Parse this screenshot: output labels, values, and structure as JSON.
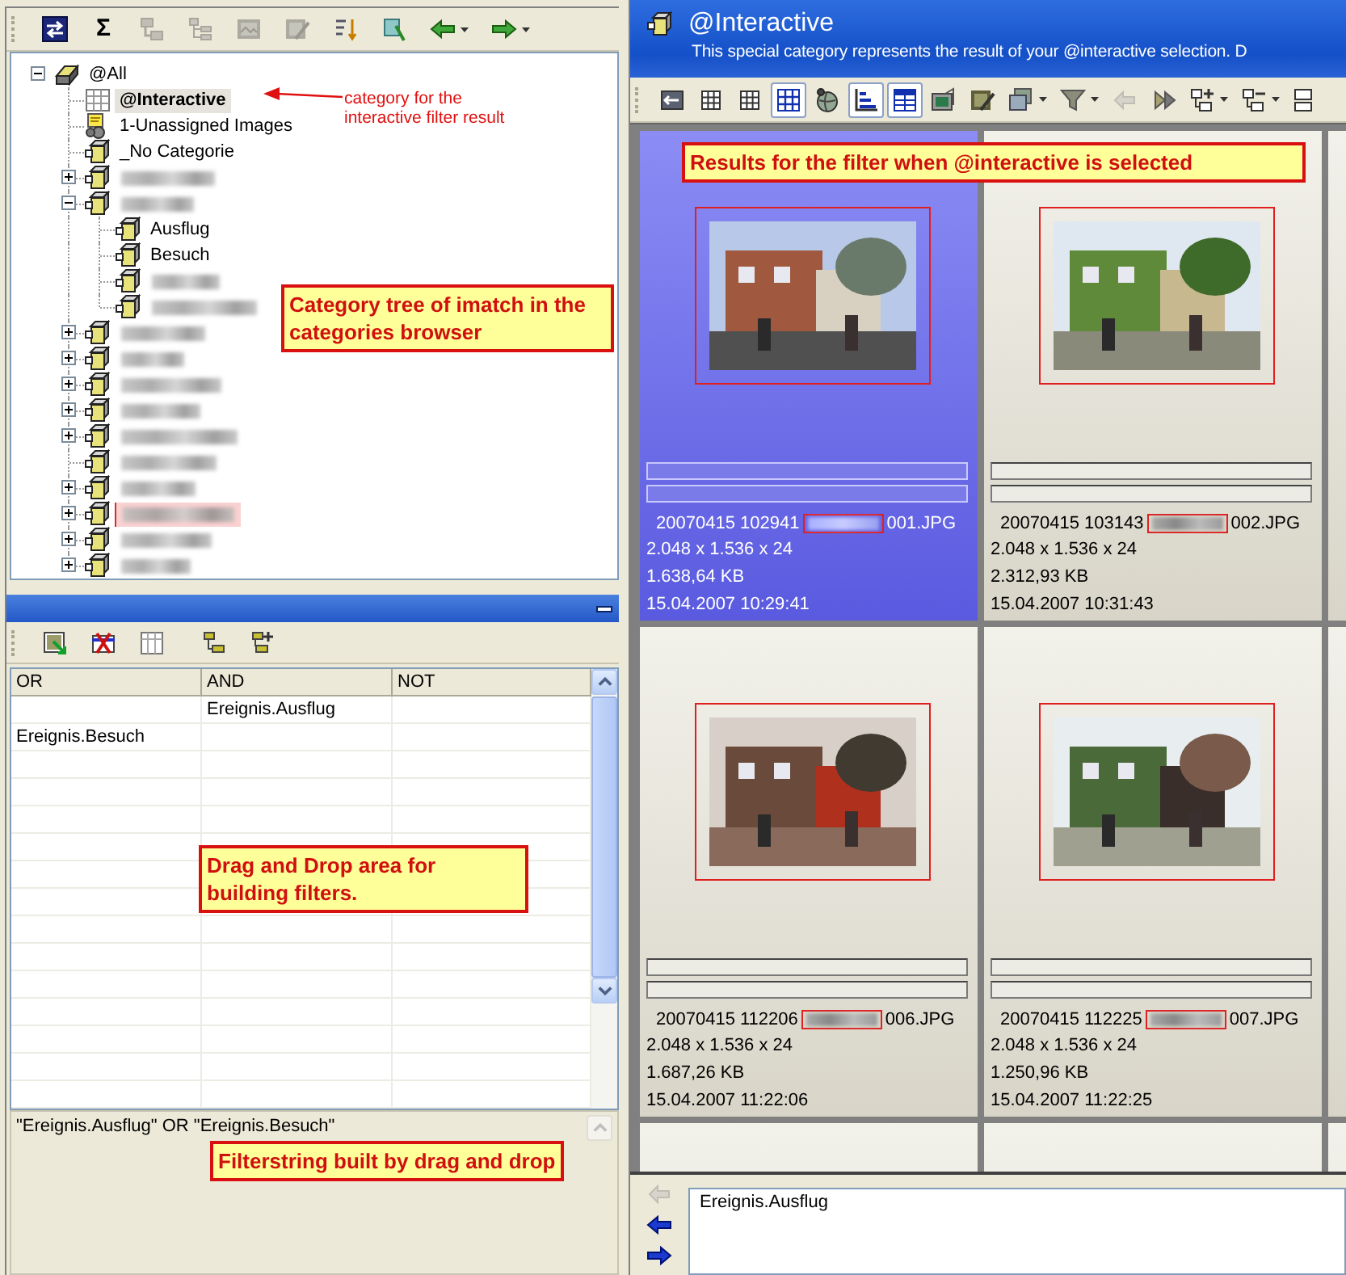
{
  "categories_toolbar": [
    {
      "kind": "swap",
      "disabled": false,
      "dropdown": false
    },
    {
      "kind": "text",
      "label": "Σ",
      "disabled": false,
      "dropdown": false
    },
    {
      "kind": "tree-collapse",
      "disabled": true,
      "dropdown": false
    },
    {
      "kind": "tree-expand",
      "disabled": true,
      "dropdown": false
    },
    {
      "kind": "image-grid",
      "disabled": true,
      "dropdown": false
    },
    {
      "kind": "image-edit",
      "disabled": true,
      "dropdown": false
    },
    {
      "kind": "sort",
      "disabled": false,
      "dropdown": false
    },
    {
      "kind": "select",
      "disabled": false,
      "dropdown": false
    },
    {
      "kind": "arrow-left",
      "disabled": false,
      "dropdown": true
    },
    {
      "kind": "arrow-right",
      "disabled": false,
      "dropdown": true
    }
  ],
  "tree": [
    {
      "kind": "drive",
      "label": "@All",
      "expanded": true,
      "selected": false,
      "highlighted": false,
      "children": [
        {
          "kind": "grid",
          "label": "@Interactive",
          "selected": true,
          "highlighted": false
        },
        {
          "kind": "special",
          "label": "1-Unassigned Images",
          "selected": false,
          "highlighted": false
        },
        {
          "kind": "category",
          "label": "_No Categorie",
          "selected": false,
          "highlighted": false
        },
        {
          "kind": "category",
          "expanded": false,
          "selected": false,
          "highlighted": false
        },
        {
          "kind": "category",
          "expanded": true,
          "selected": false,
          "highlighted": false,
          "children": [
            {
              "kind": "category",
              "label": "Ausflug",
              "selected": false,
              "highlighted": false
            },
            {
              "kind": "category",
              "label": "Besuch",
              "selected": false,
              "highlighted": false
            },
            {
              "kind": "category",
              "selected": false,
              "highlighted": false
            },
            {
              "kind": "category",
              "selected": false,
              "highlighted": false
            }
          ]
        },
        {
          "kind": "category",
          "expanded": false,
          "selected": false,
          "highlighted": false
        },
        {
          "kind": "category",
          "expanded": false,
          "selected": false,
          "highlighted": false
        },
        {
          "kind": "category",
          "expanded": false,
          "selected": false,
          "highlighted": false
        },
        {
          "kind": "category",
          "expanded": false,
          "selected": false,
          "highlighted": false
        },
        {
          "kind": "category",
          "expanded": false,
          "selected": false,
          "highlighted": false
        },
        {
          "kind": "category",
          "selected": false,
          "highlighted": false
        },
        {
          "kind": "category",
          "expanded": false,
          "selected": false,
          "highlighted": false
        },
        {
          "kind": "category",
          "expanded": false,
          "selected": false,
          "highlighted": true
        },
        {
          "kind": "category",
          "expanded": false,
          "selected": false,
          "highlighted": false
        },
        {
          "kind": "category",
          "expanded": false,
          "selected": false,
          "highlighted": false
        }
      ]
    }
  ],
  "tree_note": {
    "text": "category for the interactive filter result"
  },
  "tree_callout": {
    "text": "Category tree of imatch in the categories browser"
  },
  "filter_toolbar": [
    {
      "kind": "image-add",
      "disabled": false
    },
    {
      "kind": "delete",
      "disabled": false
    },
    {
      "kind": "table",
      "disabled": false
    },
    {
      "kind": "tree-node",
      "disabled": false
    },
    {
      "kind": "tree-add",
      "disabled": false
    }
  ],
  "filter_grid": {
    "columns": [
      "OR",
      "AND",
      "NOT"
    ],
    "rows": [
      {
        "and": "Ereignis.Ausflug"
      },
      {
        "or": "Ereignis.Besuch"
      }
    ],
    "callout": {
      "text": "Drag and Drop area for building filters."
    }
  },
  "filter_string": {
    "text": "\"Ereignis.Ausflug\" OR \"Ereignis.Besuch\"",
    "callout": {
      "text": "Filterstring built by drag and drop"
    }
  },
  "header": {
    "title": "@Interactive",
    "description": "This special category represents the result of your @interactive selection. D"
  },
  "view_toolbar": [
    {
      "kind": "exit",
      "pressed": false,
      "disabled": false,
      "dropdown": false
    },
    {
      "kind": "grid3",
      "pressed": false,
      "disabled": false,
      "dropdown": false
    },
    {
      "kind": "grid3",
      "pressed": false,
      "disabled": false,
      "dropdown": false
    },
    {
      "kind": "grid4",
      "pressed": true,
      "disabled": false,
      "dropdown": false
    },
    {
      "kind": "globe",
      "pressed": false,
      "disabled": false,
      "dropdown": false
    },
    {
      "kind": "align",
      "pressed": true,
      "disabled": false,
      "dropdown": false
    },
    {
      "kind": "table-lines",
      "pressed": true,
      "disabled": false,
      "dropdown": false
    },
    {
      "kind": "folder-image",
      "pressed": false,
      "disabled": false,
      "dropdown": false
    },
    {
      "kind": "image-edit",
      "pressed": false,
      "disabled": false,
      "dropdown": false
    },
    {
      "kind": "image-stack",
      "pressed": false,
      "disabled": false,
      "dropdown": true
    },
    {
      "kind": "filter",
      "pressed": false,
      "disabled": false,
      "dropdown": true
    },
    {
      "kind": "undo",
      "pressed": false,
      "disabled": true,
      "dropdown": false
    },
    {
      "kind": "forward",
      "pressed": false,
      "disabled": false,
      "dropdown": false
    },
    {
      "kind": "add-node",
      "pressed": false,
      "disabled": false,
      "dropdown": true
    },
    {
      "kind": "remove-node",
      "pressed": false,
      "disabled": false,
      "dropdown": true
    },
    {
      "kind": "node",
      "pressed": false,
      "disabled": false,
      "dropdown": false
    }
  ],
  "results": {
    "callout": {
      "text": "Results for the filter when @interactive is selected"
    },
    "thumbnails": [
      {
        "selected": true,
        "filename_start": "20070415 102941",
        "name_redacted": true,
        "filename_end": "001.JPG",
        "dimensions": "2.048 x 1.536 x 24",
        "size": "1.638,64 KB",
        "date": "15.04.2007 10:29:41"
      },
      {
        "selected": false,
        "filename_start": "20070415 103143",
        "name_redacted": true,
        "filename_end": "002.JPG",
        "dimensions": "2.048 x 1.536 x 24",
        "size": "2.312,93 KB",
        "date": "15.04.2007 10:31:43"
      },
      {
        "selected": false,
        "filename_start": "20070415 112206",
        "name_redacted": true,
        "filename_end": "006.JPG",
        "dimensions": "2.048 x 1.536 x 24",
        "size": "1.687,26 KB",
        "date": "15.04.2007 11:22:06"
      },
      {
        "selected": false,
        "filename_start": "20070415 112225",
        "name_redacted": true,
        "filename_end": "007.JPG",
        "dimensions": "2.048 x 1.536 x 24",
        "size": "1.250,96 KB",
        "date": "15.04.2007 11:22:25"
      }
    ]
  },
  "query_panel": {
    "buttons": [
      {
        "kind": "undo",
        "disabled": true
      },
      {
        "kind": "blue-left",
        "disabled": false
      },
      {
        "kind": "blue-right",
        "disabled": false
      }
    ],
    "text": "Ereignis.Ausflug"
  }
}
